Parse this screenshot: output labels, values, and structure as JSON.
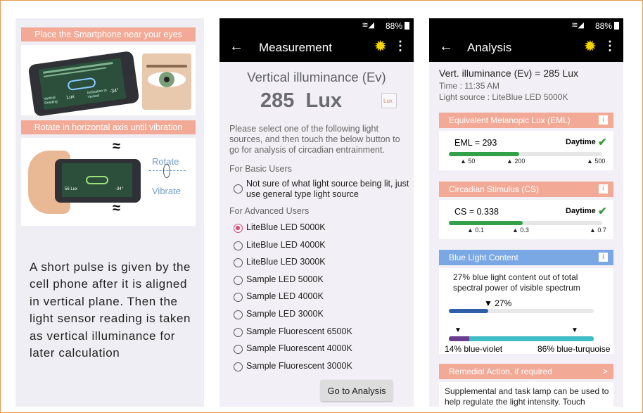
{
  "left": {
    "banner1": "Place the Smartphone near your eyes",
    "banner2": "Rotate in horizontal axis until vibration",
    "rotate": "Rotate",
    "vibrate": "Vibrate",
    "phone1_labels": [
      "Vertical Reading",
      "Lux",
      "Inclination to Vertical",
      "-34°"
    ],
    "phone2_labels": [
      "56 Lux",
      "-34°"
    ],
    "description": "A short pulse is given by the cell phone after it is aligned in vertical plane. Then the light sensor reading is taken as vertical illuminance for later calculation"
  },
  "measurement": {
    "status": "88%",
    "title": "Measurement",
    "heading": "Vertical illuminance (Ev)",
    "value": "285  Lux",
    "lux_btn": "Lux",
    "instruction": "Please select one of the following light sources, and then touch the below button to go for analysis of circadian entrainment.",
    "basic_label": "For Basic Users",
    "basic_option": "Not sure of what light source being lit, just use general type light source",
    "advanced_label": "For Advanced Users",
    "options": [
      "LiteBlue LED 5000K",
      "LiteBlue LED 4000K",
      "LiteBlue LED 3000K",
      "Sample LED 5000K",
      "Sample LED 4000K",
      "Sample LED 3000K",
      "Sample Fluorescent 6500K",
      "Sample Fluorescent 4000K",
      "Sample Fluorescent 3000K"
    ],
    "selected_index": 0,
    "button": "Go to Analysis"
  },
  "analysis": {
    "status": "88%",
    "title": "Analysis",
    "header": "Vert. illuminance (Ev) = 285 Lux",
    "time": "Time : 11:35 AM",
    "source": "Light source : LiteBlue LED 5000K",
    "eml": {
      "title": "Equivalent Melanopic Lux (EML)",
      "value": "EML = 293",
      "status": "Daytime",
      "fill": 0.46,
      "ticks": [
        "50",
        "200",
        "500"
      ]
    },
    "cs": {
      "title": "Circadian Stimulus (CS)",
      "value": "CS = 0.338",
      "status": "Daytime",
      "fill": 0.48,
      "ticks": [
        "0.1",
        "0.3",
        "0.7"
      ]
    },
    "blue": {
      "title": "Blue Light Content",
      "text": "27% blue light content out of total spectral power of visible spectrum",
      "pct_label": "27%",
      "pct": 0.27,
      "violet_label": "14% blue-violet",
      "turq_label": "86% blue-turquoise",
      "violet": 0.14
    },
    "remedial": {
      "title": "Remedial Action, if required",
      "arrow": ">",
      "text": "Supplemental and task lamp can be used to help regulate the light intensity. Touch"
    }
  }
}
